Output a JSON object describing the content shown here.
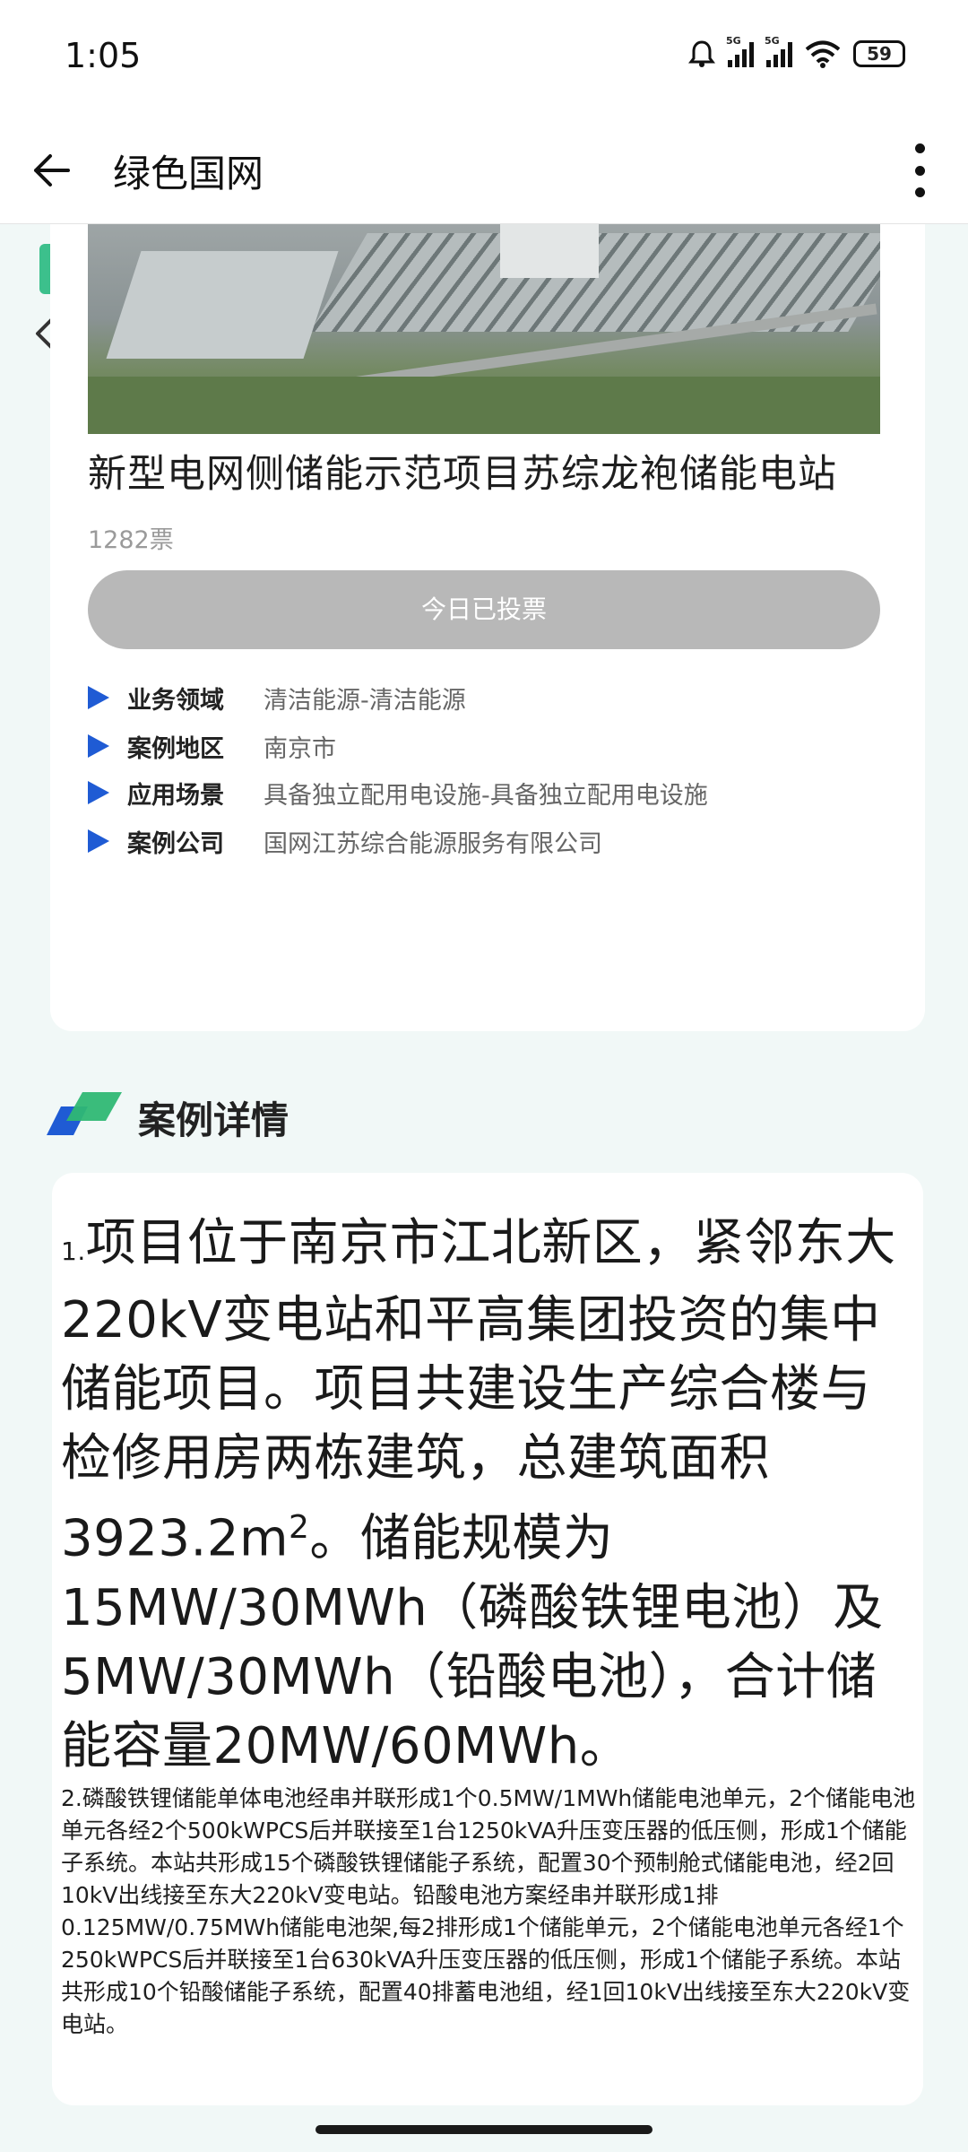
{
  "status": {
    "time": "1:05",
    "battery": "59",
    "signal_tag": "5G"
  },
  "nav": {
    "title": "绿色国网"
  },
  "project": {
    "title": "新型电网侧储能示范项目苏综龙袍储能电站",
    "votes": "1282票",
    "vote_button": "今日已投票",
    "info": [
      {
        "label": "业务领域",
        "value": "清洁能源-清洁能源"
      },
      {
        "label": "案例地区",
        "value": "南京市"
      },
      {
        "label": "应用场景",
        "value": "具备独立配用电设施-具备独立配用电设施"
      },
      {
        "label": "案例公司",
        "value": "国网江苏综合能源服务有限公司"
      }
    ]
  },
  "section": {
    "title": "案例详情"
  },
  "details": {
    "p1_num": "1.",
    "p1_a": "项目位于南京市江北新区，紧邻东大220kV变电站和平高集团投资的集中储能项目。项目共建设生产综合楼与检修用房两栋建筑，总建筑面积3923.2m",
    "p1_sup": "2",
    "p1_b": "。储能规模为15MW/30MWh（磷酸铁锂电池）及5MW/30MWh（铅酸电池），合计储能容量20MW/60MWh。",
    "p2": "2.磷酸铁锂储能单体电池经串并联形成1个0.5MW/1MWh储能电池单元，2个储能电池单元各经2个500kWPCS后并联接至1台1250kVA升压变压器的低压侧，形成1个储能子系统。本站共形成15个磷酸铁锂储能子系统，配置30个预制舱式储能电池，经2回10kV出线接至东大220kV变电站。铅酸电池方案经串并联形成1排0.125MW/0.75MWh储能电池架,每2排形成1个储能单元，2个储能电池单元各经1个250kWPCS后并联接至1台630kVA升压变压器的低压侧，形成1个储能子系统。本站共形成10个铅酸储能子系统，配置40排蓄电池组，经1回10kV出线接至东大220kV变电站。"
  }
}
